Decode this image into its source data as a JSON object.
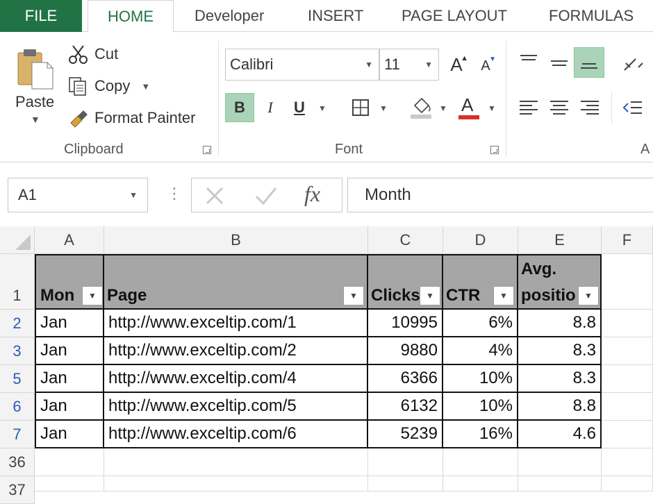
{
  "tabs": [
    "FILE",
    "HOME",
    "Developer",
    "INSERT",
    "PAGE LAYOUT",
    "FORMULAS"
  ],
  "clipboard": {
    "paste": "Paste",
    "cut": "Cut",
    "copy": "Copy",
    "format_painter": "Format Painter",
    "group_label": "Clipboard"
  },
  "font": {
    "name": "Calibri",
    "size": "11",
    "group_label": "Font",
    "bold": "B",
    "italic": "I",
    "underline": "U",
    "font_color_letter": "A",
    "font_color": "#d9302c",
    "grow_letter": "A",
    "shrink_letter": "A"
  },
  "alignment": {
    "group_label": "A"
  },
  "formula_bar": {
    "name_box": "A1",
    "fx": "fx",
    "content": "Month"
  },
  "columns": [
    "A",
    "B",
    "C",
    "D",
    "E",
    "F"
  ],
  "headers": {
    "month": "Mon",
    "page": "Page",
    "clicks": "Clicks",
    "ctr": "CTR",
    "avg_line1": "Avg.",
    "avg_line2": "positio"
  },
  "rows": [
    {
      "num": "1"
    },
    {
      "num": "2",
      "month": "Jan",
      "page": "http://www.exceltip.com/1",
      "clicks": "10995",
      "ctr": "6%",
      "avg": "8.8"
    },
    {
      "num": "3",
      "month": "Jan",
      "page": "http://www.exceltip.com/2",
      "clicks": "9880",
      "ctr": "4%",
      "avg": "8.3"
    },
    {
      "num": "5",
      "month": "Jan",
      "page": "http://www.exceltip.com/4",
      "clicks": "6366",
      "ctr": "10%",
      "avg": "8.3"
    },
    {
      "num": "6",
      "month": "Jan",
      "page": "http://www.exceltip.com/5",
      "clicks": "6132",
      "ctr": "10%",
      "avg": "8.8"
    },
    {
      "num": "7",
      "month": "Jan",
      "page": "http://www.exceltip.com/6",
      "clicks": "5239",
      "ctr": "16%",
      "avg": "4.6"
    },
    {
      "num": "36"
    },
    {
      "num": "37"
    }
  ],
  "colors": {
    "file_tab": "#217346",
    "header_fill": "#a6a6a6",
    "filtered_row_number": "#2a5bb8",
    "active_button": "#a9d4b8"
  }
}
